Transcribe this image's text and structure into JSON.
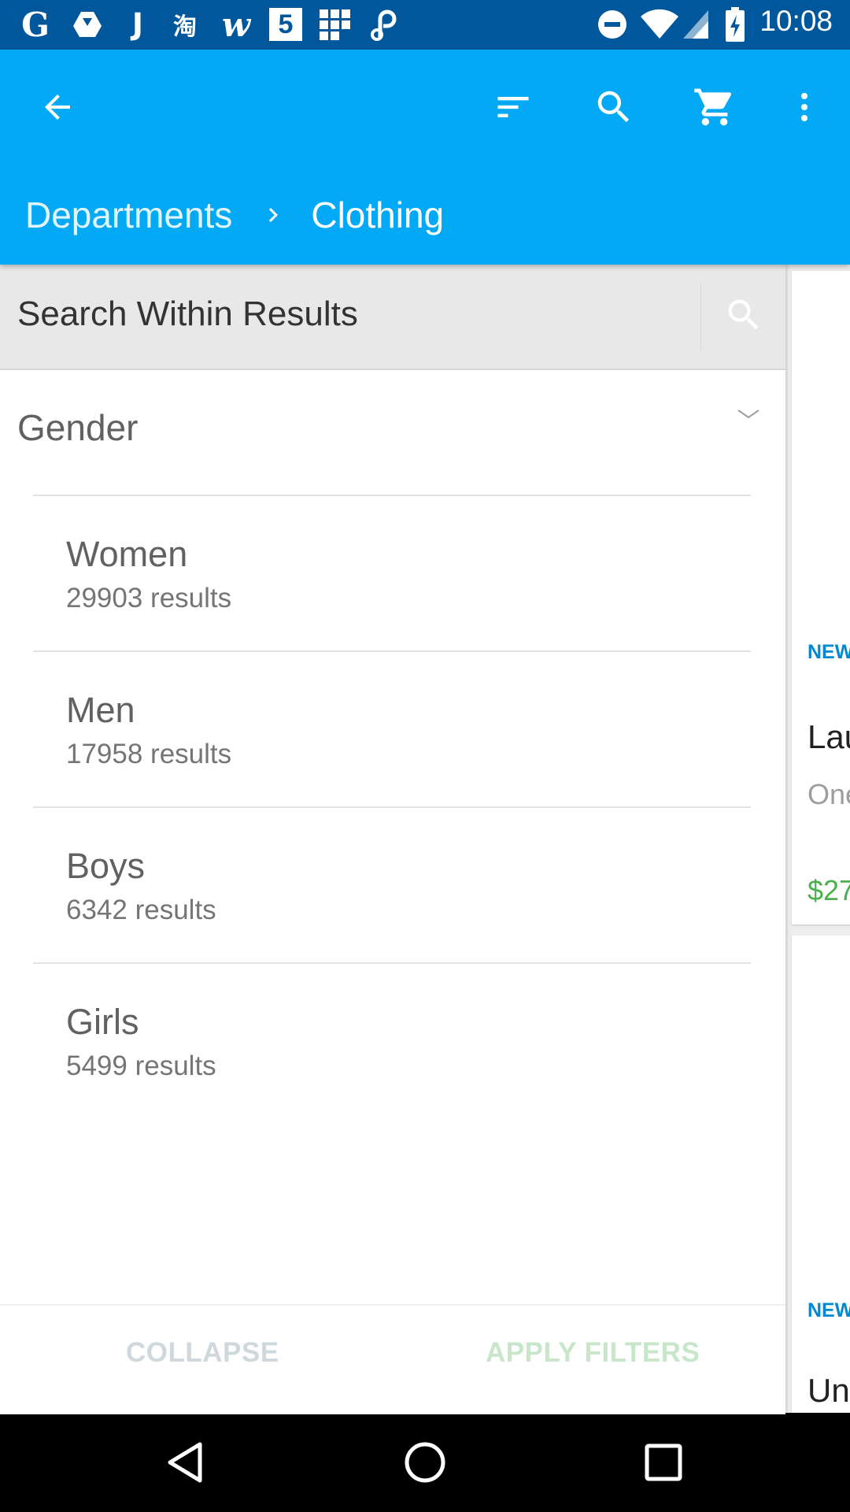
{
  "status_bar": {
    "time": "10:08",
    "notification_icons": [
      "google-icon",
      "drive-icon",
      "j-app-icon",
      "taobao-icon",
      "wish-icon",
      "five-app-icon",
      "grid-app-icon",
      "link-app-icon"
    ],
    "system_icons": [
      "do-not-disturb-icon",
      "wifi-icon",
      "cell-signal-icon",
      "battery-charging-icon"
    ],
    "labels": {
      "g": "G",
      "j": "J",
      "taobao": "淘",
      "wish": "w",
      "five": "5"
    }
  },
  "app_bar": {
    "color": "#03a9f4",
    "actions": [
      "back-arrow-icon",
      "sort-icon",
      "search-icon",
      "cart-icon",
      "more-vert-icon"
    ],
    "breadcrumb": [
      {
        "label": "Departments"
      },
      {
        "label": "Clothing"
      }
    ]
  },
  "filters": {
    "search_placeholder": "Search Within Results",
    "section": {
      "title": "Gender",
      "options": [
        {
          "label": "Women",
          "count": "29903 results"
        },
        {
          "label": "Men",
          "count": "17958 results"
        },
        {
          "label": "Boys",
          "count": "6342 results"
        },
        {
          "label": "Girls",
          "count": "5499 results"
        }
      ]
    },
    "footer": {
      "collapse_label": "COLLAPSE",
      "apply_label": "APPLY FILTERS"
    }
  },
  "products_peek": {
    "cards": [
      {
        "badge": "NEW",
        "title": "Lau",
        "subtitle": "One",
        "price": "$27"
      },
      {
        "badge": "NEW",
        "title": "Un"
      }
    ]
  },
  "nav_bar": {
    "buttons": [
      "back-triangle-icon",
      "home-circle-icon",
      "recents-square-icon"
    ]
  }
}
